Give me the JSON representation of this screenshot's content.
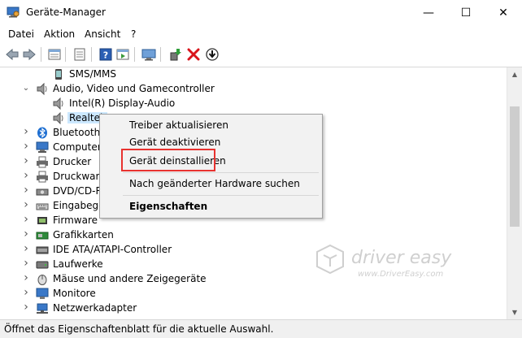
{
  "window": {
    "title": "Geräte-Manager",
    "minimize": "—",
    "maximize": "☐",
    "close": "✕"
  },
  "menu": [
    "Datei",
    "Aktion",
    "Ansicht",
    "?"
  ],
  "tree": {
    "items": [
      {
        "label": "SMS/MMS",
        "level": 2,
        "expanded": false,
        "icon": "sms-device-icon"
      },
      {
        "label": "Audio, Video und Gamecontroller",
        "level": 1,
        "expanded": true,
        "icon": "speaker-icon"
      },
      {
        "label": "Intel(R) Display-Audio",
        "level": 2,
        "icon": "speaker-icon"
      },
      {
        "label": "Realtek",
        "level": 2,
        "selected": true,
        "icon": "speaker-icon"
      },
      {
        "label": "Bluetooth",
        "level": 1,
        "icon": "bluetooth-icon"
      },
      {
        "label": "Computer",
        "level": 1,
        "icon": "computer-icon"
      },
      {
        "label": "Drucker",
        "level": 1,
        "icon": "printer-icon"
      },
      {
        "label": "Druckwarte",
        "level": 1,
        "icon": "printer-icon"
      },
      {
        "label": "DVD/CD-R",
        "level": 1,
        "icon": "dvd-icon"
      },
      {
        "label": "Eingabeger",
        "level": 1,
        "icon": "keyboard-icon"
      },
      {
        "label": "Firmware",
        "level": 1,
        "icon": "firmware-icon"
      },
      {
        "label": "Grafikkarten",
        "level": 1,
        "icon": "display-adapter-icon"
      },
      {
        "label": "IDE ATA/ATAPI-Controller",
        "level": 1,
        "icon": "ide-controller-icon"
      },
      {
        "label": "Laufwerke",
        "level": 1,
        "icon": "disk-drive-icon"
      },
      {
        "label": "Mäuse und andere Zeigegeräte",
        "level": 1,
        "icon": "mouse-icon"
      },
      {
        "label": "Monitore",
        "level": 1,
        "icon": "monitor-icon"
      },
      {
        "label": "Netzwerkadapter",
        "level": 1,
        "icon": "network-adapter-icon"
      }
    ]
  },
  "context_menu": {
    "items": [
      "Treiber aktualisieren",
      "Gerät deaktivieren",
      "Gerät deinstallieren",
      "Nach geänderter Hardware suchen",
      "Eigenschaften"
    ],
    "highlighted": "Gerät deinstallieren",
    "highlight_color": "#e8322f"
  },
  "watermark": {
    "brand": "driver easy",
    "url": "www.DriverEasy.com"
  },
  "status": "Öffnet das Eigenschaftenblatt für die aktuelle Auswahl."
}
